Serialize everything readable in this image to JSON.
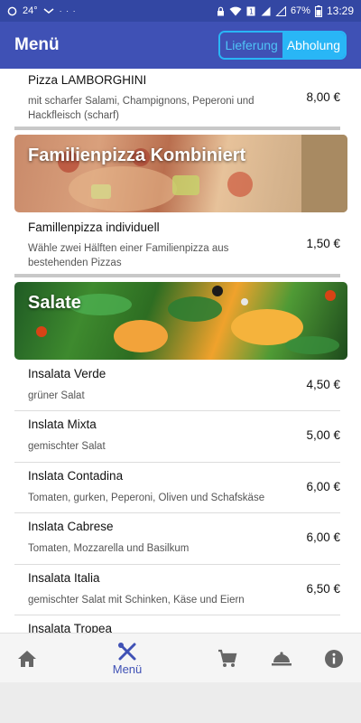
{
  "status_bar": {
    "temperature": "24°",
    "battery": "67%",
    "time": "13:29",
    "dots": "· · ·"
  },
  "header": {
    "title": "Menü",
    "toggle": {
      "left_label": "Lieferung",
      "right_label": "Abholung",
      "selected": "Abholung"
    }
  },
  "menu": {
    "pizza_item": {
      "name": "Pizza LAMBORGHINI",
      "description": "mit scharfer Salami, Champignons, Peperoni und Hackfleisch (scharf)",
      "price": "8,00 €"
    },
    "family_section": {
      "title": "Familienpizza Kombiniert"
    },
    "family_item": {
      "name": "Famillenpizza individuell",
      "description": "Wähle zwei Hälften einer Familienpizza aus bestehenden Pizzas",
      "price": "1,50 €"
    },
    "salad_section": {
      "title": "Salate"
    },
    "salads": [
      {
        "name": "Insalata Verde",
        "description": "grüner Salat",
        "price": "4,50 €"
      },
      {
        "name": "Inslata Mixta",
        "description": "gemischter Salat",
        "price": "5,00 €"
      },
      {
        "name": "Inslata Contadina",
        "description": "Tomaten, gurken, Peperoni, Oliven und Schafskäse",
        "price": "6,00 €"
      },
      {
        "name": "Inslata Cabrese",
        "description": "Tomaten, Mozzarella und Basilkum",
        "price": "6,00 €"
      },
      {
        "name": "Insalata Italia",
        "description": "gemischter Salat mit Schinken, Käse und Eiern",
        "price": "6,50 €"
      },
      {
        "name": "Insalata Tropea",
        "description": "",
        "price": ""
      }
    ]
  },
  "bottom_nav": {
    "items": [
      {
        "icon": "home-icon"
      },
      {
        "icon": "cutlery-icon",
        "label": "Menü"
      },
      {
        "icon": "cart-icon"
      },
      {
        "icon": "cloche-icon"
      },
      {
        "icon": "info-icon"
      }
    ]
  },
  "colors": {
    "app_bar": "#3f51b5",
    "status_bar": "#3347a3",
    "accent": "#29b6f6"
  }
}
